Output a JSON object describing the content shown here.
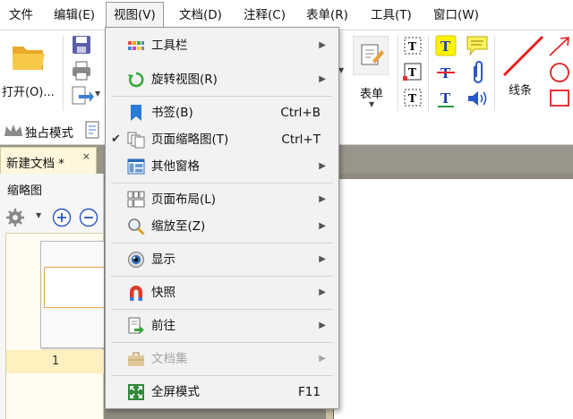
{
  "menubar": {
    "items": [
      "文件",
      "编辑(E)",
      "视图(V)",
      "文档(D)",
      "注释(C)",
      "表单(R)",
      "工具(T)",
      "窗口(W)"
    ]
  },
  "ribbon": {
    "open_label": "打开(O)...",
    "form_label": "表单",
    "line_label": "线条"
  },
  "subbar": {
    "exclusive_mode_label": "独占模式"
  },
  "tab": {
    "title": "新建文档 *",
    "close": "×"
  },
  "panel": {
    "title": "缩略图",
    "page_number": "1"
  },
  "view_menu": {
    "items": [
      {
        "label": "工具栏",
        "shortcut": "",
        "submenu": true,
        "icon": "toolbar-icon"
      },
      {
        "label": "旋转视图(R)",
        "shortcut": "",
        "submenu": true,
        "icon": "rotate-icon"
      },
      {
        "label": "书签(B)",
        "shortcut": "Ctrl+B",
        "submenu": false,
        "icon": "bookmark-icon"
      },
      {
        "label": "页面缩略图(T)",
        "shortcut": "Ctrl+T",
        "submenu": false,
        "checked": true,
        "icon": "thumbnails-icon"
      },
      {
        "label": "其他窗格",
        "shortcut": "",
        "submenu": true,
        "icon": "panes-icon"
      },
      {
        "label": "页面布局(L)",
        "shortcut": "",
        "submenu": true,
        "icon": "page-layout-icon"
      },
      {
        "label": "缩放至(Z)",
        "shortcut": "",
        "submenu": true,
        "icon": "zoom-icon"
      },
      {
        "label": "显示",
        "shortcut": "",
        "submenu": true,
        "icon": "eye-icon"
      },
      {
        "label": "快照",
        "shortcut": "",
        "submenu": true,
        "icon": "magnet-icon"
      },
      {
        "label": "前往",
        "shortcut": "",
        "submenu": true,
        "icon": "goto-icon"
      },
      {
        "label": "文档集",
        "shortcut": "",
        "submenu": true,
        "disabled": true,
        "icon": "briefcase-icon"
      },
      {
        "label": "全屏模式",
        "shortcut": "F11",
        "submenu": false,
        "icon": "fullscreen-icon"
      }
    ],
    "check_mark": "✔",
    "submenu_arrow": "▶"
  }
}
